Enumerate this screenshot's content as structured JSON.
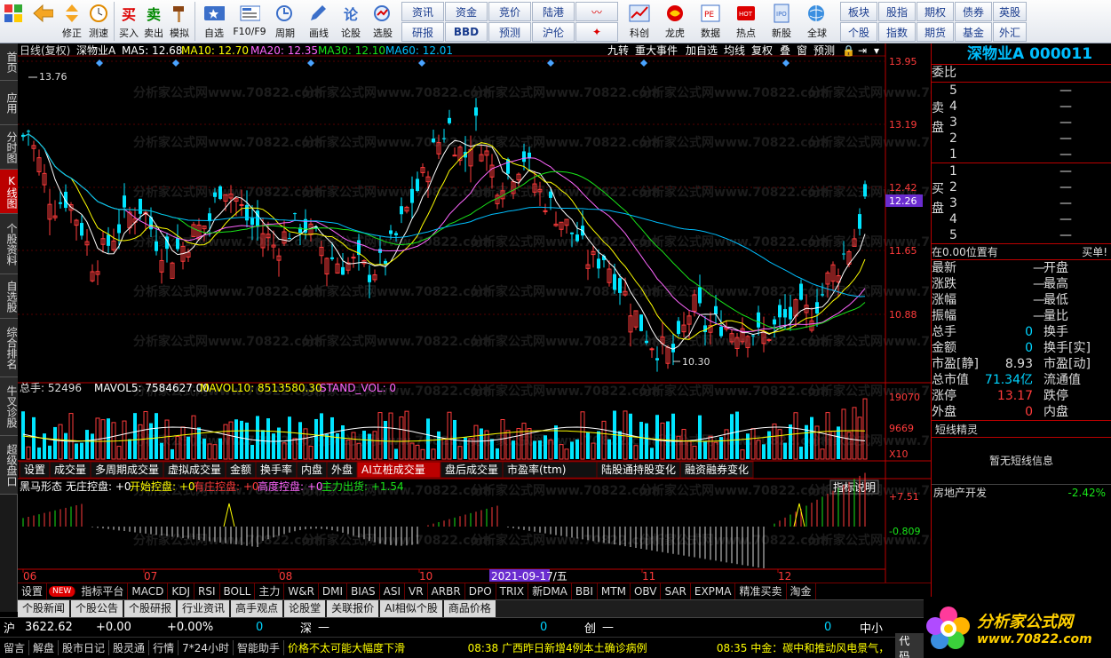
{
  "toolbar": {
    "left": [
      {
        "label": "",
        "icon": "grid-icon"
      },
      {
        "label": "",
        "icon": "back-arrow-icon"
      },
      {
        "label": "修正",
        "icon": "updown-icon"
      },
      {
        "label": "测速",
        "icon": "clock-icon"
      },
      {
        "label": "买入",
        "icon": "buy-icon"
      },
      {
        "label": "卖出",
        "icon": "sell-icon"
      },
      {
        "label": "模拟",
        "icon": "hammer-icon"
      },
      {
        "label": "自选",
        "icon": "star-icon"
      },
      {
        "label": "F10/F9",
        "icon": "doc-icon"
      },
      {
        "label": "周期",
        "icon": "cycle-icon"
      },
      {
        "label": "画线",
        "icon": "pen-icon"
      },
      {
        "label": "论股",
        "icon": "discuss-icon"
      },
      {
        "label": "选股",
        "icon": "select-icon"
      }
    ],
    "grid1": [
      "资讯",
      "资金",
      "竞价",
      "陆港",
      "",
      "研报",
      "BBD",
      "预测",
      "沪伦",
      ""
    ],
    "mid": [
      {
        "label": "科创"
      },
      {
        "label": "龙虎"
      },
      {
        "label": "数据"
      },
      {
        "label": "热点"
      },
      {
        "label": "新股"
      },
      {
        "label": "全球"
      }
    ],
    "grid2": [
      "板块",
      "股指",
      "期权",
      "债券",
      "英股",
      "个股",
      "指数",
      "期货",
      "基金",
      "外汇"
    ]
  },
  "lefttabs": [
    {
      "label": "首页"
    },
    {
      "label": "应用"
    },
    {
      "label": "分时图"
    },
    {
      "label": "K线图",
      "active": true
    },
    {
      "label": "个股资料"
    },
    {
      "label": "自选股"
    },
    {
      "label": "综合排名"
    },
    {
      "label": "牛叉诊股"
    },
    {
      "label": "超级盘口"
    }
  ],
  "chart": {
    "period": "日线(复权)",
    "stock": "深物业A",
    "ma5": "MA5: 12.68",
    "ma10": "MA10: 12.70",
    "ma20": "MA20: 12.35",
    "ma30": "MA30: 12.10",
    "ma60": "MA60: 12.01",
    "topbtns": [
      "九转",
      "重大事件",
      "加自选",
      "均线",
      "复权",
      "叠",
      "窗",
      "预测"
    ],
    "prices": [
      "13.95",
      "13.19",
      "12.42",
      "11.65",
      "10.88"
    ],
    "curprice": "12.26",
    "high": "13.76",
    "low": "10.30",
    "vol_line": "总手: 52496",
    "mavol5": "MAVOL5: 7584627.00",
    "mavol10": "MAVOL10: 8513580.30",
    "standvol": "STAND_VOL: 0",
    "vol_ticks": [
      "19070",
      "9669"
    ],
    "vol_unit": "X10",
    "voltabs": [
      "设置",
      "成交量",
      "多周期成交量",
      "虚拟成交量",
      "金额",
      "换手率",
      "内盘",
      "外盘",
      "AI立桩成交量",
      "盘后成交量",
      "市盈率(ttm)",
      "陆股通持股变化",
      "融资融券变化"
    ],
    "ind_name": "黑马形态",
    "ind_vals": [
      "无庄控盘: +0",
      "开始控盘: +0",
      "有庄控盘: +0",
      "高度控盘: +0",
      "主力出货: +1.54"
    ],
    "ind_btn": "指标说明",
    "ind_ticks": [
      "+7.51",
      "-0.809"
    ],
    "months": [
      "06",
      "07",
      "08",
      "09",
      "10",
      "11",
      "12"
    ],
    "cursor_date": "2021-09-17/五",
    "watermark": "分析家公式网www.70822.com"
  },
  "chart_data": {
    "type": "candlestick",
    "ylim": [
      10.3,
      13.95
    ],
    "high": 13.76,
    "low": 10.3,
    "last": 12.26,
    "ma": {
      "MA5": 12.68,
      "MA10": 12.7,
      "MA20": 12.35,
      "MA30": 12.1,
      "MA60": 12.01
    }
  },
  "right": {
    "title": "深物业A 000011",
    "weibi": "委比",
    "sell": [
      "5",
      "4",
      "3",
      "2",
      "1"
    ],
    "buy": [
      "1",
      "2",
      "3",
      "4",
      "5"
    ],
    "sell_lbl": "卖",
    "pan": "盘",
    "buy_lbl": "买",
    "dash": "—",
    "at": "在0.00位置有",
    "order": "买单!",
    "stats": [
      [
        "最新",
        "",
        "开盘",
        ""
      ],
      [
        "涨跌",
        "",
        "最高",
        ""
      ],
      [
        "涨幅",
        "",
        "最低",
        ""
      ],
      [
        "振幅",
        "",
        "量比",
        ""
      ],
      [
        "总手",
        "0",
        "换手",
        ""
      ],
      [
        "金额",
        "0",
        "换手[实]",
        ""
      ],
      [
        "市盈[静]",
        "8.93",
        "市盈[动]",
        ""
      ],
      [
        "总市值",
        "71.34亿",
        "流通值",
        ""
      ],
      [
        "涨停",
        "13.17",
        "跌停",
        ""
      ],
      [
        "外盘",
        "0",
        "内盘",
        ""
      ]
    ],
    "short": "短线精灵",
    "noshort": "暂无短线信息",
    "sector": "房地产开发",
    "sector_chg": "-2.42%"
  },
  "bottomtabs": [
    "设置",
    "NEW",
    "指标平台",
    "MACD",
    "KDJ",
    "RSI",
    "BOLL",
    "主力",
    "W&R",
    "DMI",
    "BIAS",
    "ASI",
    "VR",
    "ARBR",
    "DPO",
    "TRIX",
    "新DMA",
    "BBI",
    "MTM",
    "OBV",
    "SAR",
    "EXPMA",
    "精准买卖",
    "淘金"
  ],
  "newstabs": [
    "个股新闻",
    "个股公告",
    "个股研报",
    "行业资讯",
    "高手观点",
    "论股堂",
    "关联报价",
    "AI相似个股",
    "商品价格"
  ],
  "status": {
    "sh": "沪",
    "sh_idx": "3622.62",
    "sh_chg": "+0.00",
    "sh_pct": "+0.00%",
    "sh_vol": "0",
    "sz": "深",
    "sz_v": "—",
    "sz_vol": "0",
    "cy": "创",
    "cy_v": "—",
    "cy_vol": "0",
    "zx": "中小"
  },
  "ticker": [
    "留言",
    "解盘",
    "股市日记",
    "股灵通",
    "行情",
    "7*24小时",
    "智能助手"
  ],
  "news": [
    "价格不太可能大幅度下滑",
    "08:38 广西昨日新增4例本土确诊病例",
    "08:35 中金：碳中和推动风电景气，",
    "代码"
  ],
  "logo": "分析家公式网",
  "logo_url": "www.70822.com"
}
